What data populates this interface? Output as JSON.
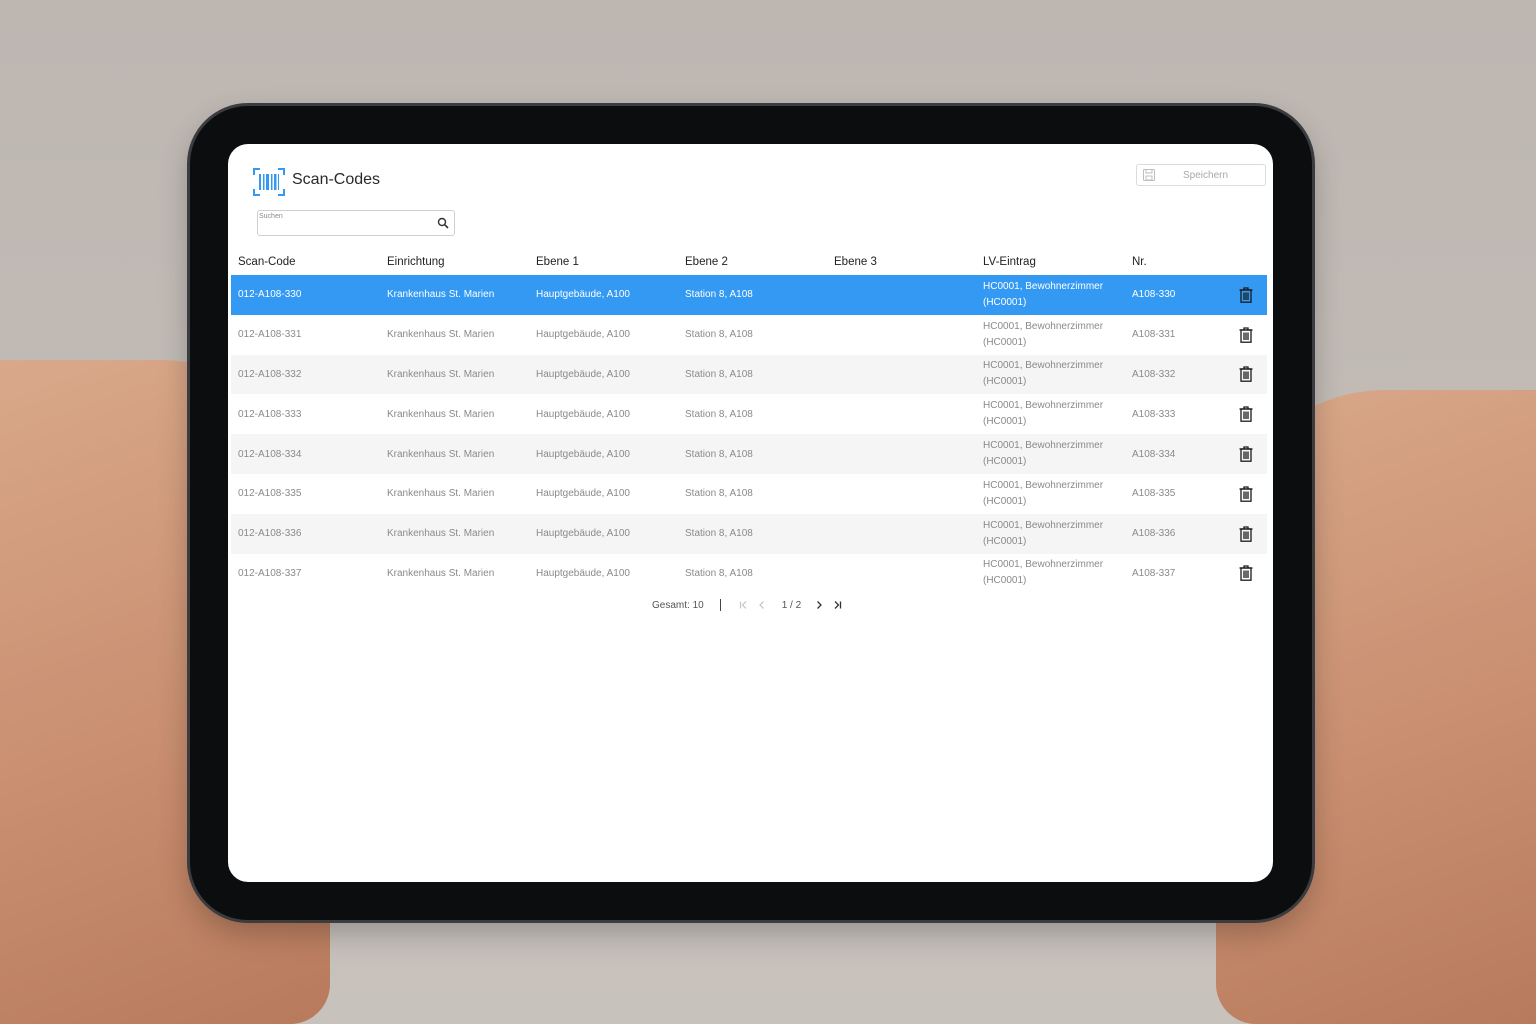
{
  "app": {
    "title": "Scan-Codes",
    "logo_icon": "barcode-scan-icon",
    "accent_color": "#3399f3"
  },
  "toolbar": {
    "save_label": "Speichern",
    "save_icon": "floppy-disk-icon"
  },
  "search": {
    "label": "Suchen",
    "value": "",
    "icon": "search-icon"
  },
  "table": {
    "columns": [
      "Scan-Code",
      "Einrichtung",
      "Ebene 1",
      "Ebene 2",
      "Ebene 3",
      "LV-Eintrag",
      "Nr."
    ],
    "selected_index": 0,
    "rows": [
      {
        "scan_code": "012-A108-330",
        "einrichtung": "Krankenhaus St. Marien",
        "ebene1": "Hauptgebäude, A100",
        "ebene2": "Station 8, A108",
        "ebene3": "",
        "lv_eintrag": "HC0001, Bewohnerzimmer (HC0001)",
        "nr": "A108-330"
      },
      {
        "scan_code": "012-A108-331",
        "einrichtung": "Krankenhaus St. Marien",
        "ebene1": "Hauptgebäude, A100",
        "ebene2": "Station 8, A108",
        "ebene3": "",
        "lv_eintrag": "HC0001, Bewohnerzimmer (HC0001)",
        "nr": "A108-331"
      },
      {
        "scan_code": "012-A108-332",
        "einrichtung": "Krankenhaus St. Marien",
        "ebene1": "Hauptgebäude, A100",
        "ebene2": "Station 8, A108",
        "ebene3": "",
        "lv_eintrag": "HC0001, Bewohnerzimmer (HC0001)",
        "nr": "A108-332"
      },
      {
        "scan_code": "012-A108-333",
        "einrichtung": "Krankenhaus St. Marien",
        "ebene1": "Hauptgebäude, A100",
        "ebene2": "Station 8, A108",
        "ebene3": "",
        "lv_eintrag": "HC0001, Bewohnerzimmer (HC0001)",
        "nr": "A108-333"
      },
      {
        "scan_code": "012-A108-334",
        "einrichtung": "Krankenhaus St. Marien",
        "ebene1": "Hauptgebäude, A100",
        "ebene2": "Station 8, A108",
        "ebene3": "",
        "lv_eintrag": "HC0001, Bewohnerzimmer (HC0001)",
        "nr": "A108-334"
      },
      {
        "scan_code": "012-A108-335",
        "einrichtung": "Krankenhaus St. Marien",
        "ebene1": "Hauptgebäude, A100",
        "ebene2": "Station 8, A108",
        "ebene3": "",
        "lv_eintrag": "HC0001, Bewohnerzimmer (HC0001)",
        "nr": "A108-335"
      },
      {
        "scan_code": "012-A108-336",
        "einrichtung": "Krankenhaus St. Marien",
        "ebene1": "Hauptgebäude, A100",
        "ebene2": "Station 8, A108",
        "ebene3": "",
        "lv_eintrag": "HC0001, Bewohnerzimmer (HC0001)",
        "nr": "A108-336"
      },
      {
        "scan_code": "012-A108-337",
        "einrichtung": "Krankenhaus St. Marien",
        "ebene1": "Hauptgebäude, A100",
        "ebene2": "Station 8, A108",
        "ebene3": "",
        "lv_eintrag": "HC0001, Bewohnerzimmer (HC0001)",
        "nr": "A108-337"
      }
    ],
    "row_action_icon": "trash-icon"
  },
  "pagination": {
    "total_label": "Gesamt: 10",
    "page_indicator": "1 / 2",
    "first_icon": "first-page-icon",
    "prev_icon": "chevron-left-icon",
    "next_icon": "chevron-right-icon",
    "last_icon": "last-page-icon"
  }
}
